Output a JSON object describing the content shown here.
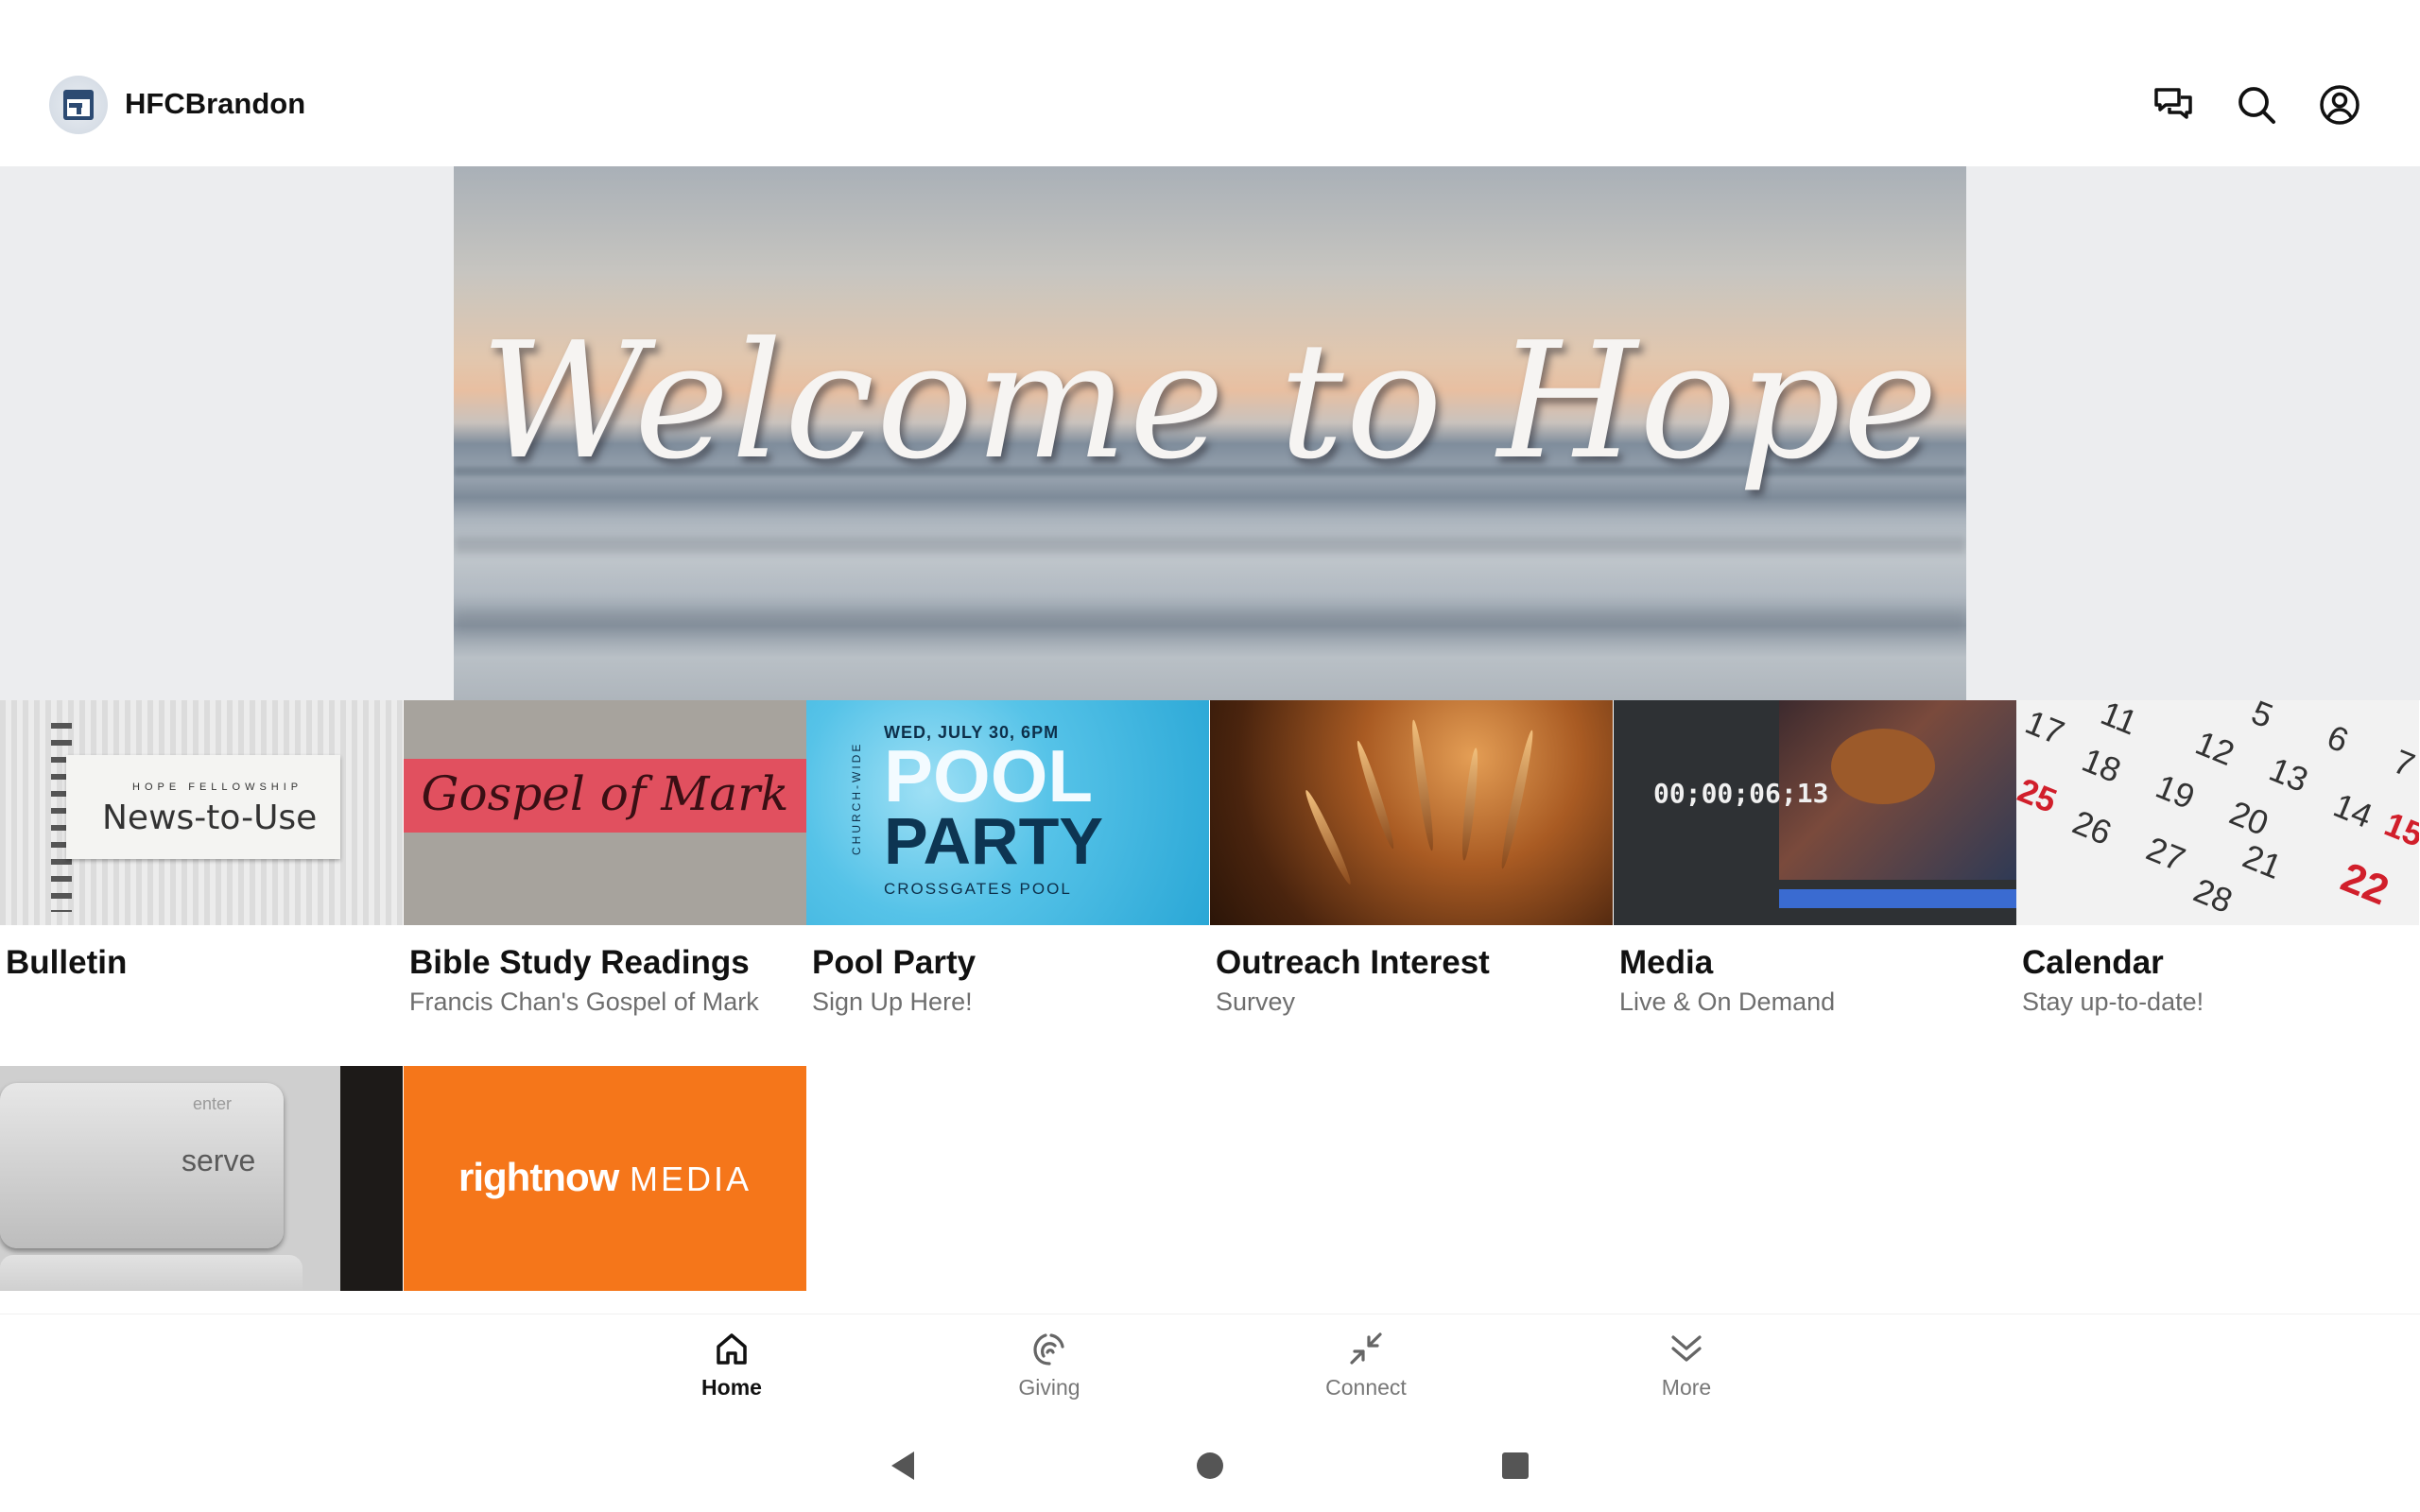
{
  "header": {
    "brand_name": "HFCBrandon",
    "icons": [
      "chat-icon",
      "search-icon",
      "account-icon"
    ]
  },
  "hero": {
    "title": "Welcome to Hope"
  },
  "tiles": [
    {
      "title": "Bulletin",
      "subtitle": "",
      "image_text": {
        "small": "HOPE FELLOWSHIP",
        "big": "News-to-Use"
      }
    },
    {
      "title": "Bible Study Readings",
      "subtitle": "Francis Chan's Gospel of Mark",
      "image_text": {
        "big": "Gospel of Mark"
      }
    },
    {
      "title": "Pool Party",
      "subtitle": "Sign Up Here!",
      "image_text": {
        "date": "WED, JULY 30, 6PM",
        "line1": "POOL",
        "line2": "PARTY",
        "location": "CROSSGATES POOL",
        "side": "CHURCH-WIDE"
      }
    },
    {
      "title": "Outreach Interest",
      "subtitle": "Survey"
    },
    {
      "title": "Media",
      "subtitle": "Live & On Demand",
      "image_text": {
        "timecode": "00;00;06;13"
      }
    },
    {
      "title": "Calendar",
      "subtitle": "Stay up-to-date!",
      "image_text": {
        "numbers": [
          "17",
          "11",
          "12",
          "13",
          "5",
          "6",
          "7",
          "18",
          "19",
          "20",
          "14",
          "25",
          "26",
          "27",
          "21",
          "15",
          "28",
          "22"
        ]
      }
    }
  ],
  "tiles_row2": [
    {
      "image_text": {
        "key_label": "serve",
        "key_top": "enter"
      }
    },
    {
      "image_text": {
        "brand_bold": "rightnow",
        "brand_light": "MEDIA"
      }
    }
  ],
  "bottom_nav": {
    "items": [
      {
        "label": "Home",
        "icon": "home-icon",
        "active": true
      },
      {
        "label": "Giving",
        "icon": "giving-icon",
        "active": false
      },
      {
        "label": "Connect",
        "icon": "connect-icon",
        "active": false
      },
      {
        "label": "More",
        "icon": "chevron-double-down-icon",
        "active": false
      }
    ]
  },
  "system_bar": {
    "buttons": [
      "back-icon",
      "home-circle-icon",
      "recents-icon"
    ]
  }
}
